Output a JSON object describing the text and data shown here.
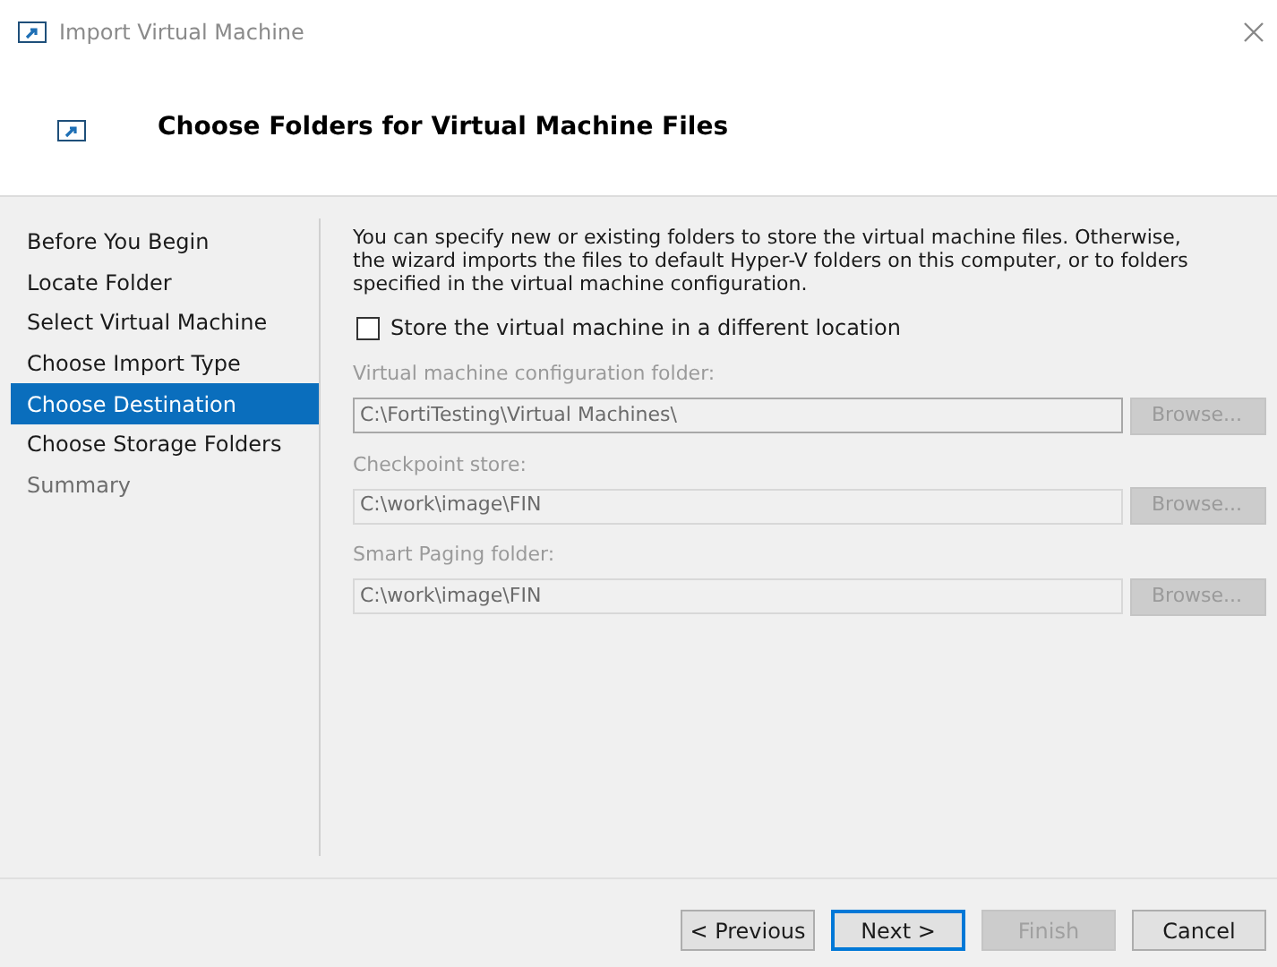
{
  "window": {
    "title": "Import Virtual Machine"
  },
  "header": {
    "title": "Choose Folders for Virtual Machine Files"
  },
  "steps": [
    {
      "label": "Before You Begin",
      "selected": false,
      "disabled": false
    },
    {
      "label": "Locate Folder",
      "selected": false,
      "disabled": false
    },
    {
      "label": "Select Virtual Machine",
      "selected": false,
      "disabled": false
    },
    {
      "label": "Choose Import Type",
      "selected": false,
      "disabled": false
    },
    {
      "label": "Choose Destination",
      "selected": true,
      "disabled": false
    },
    {
      "label": "Choose Storage Folders",
      "selected": false,
      "disabled": false
    },
    {
      "label": "Summary",
      "selected": false,
      "disabled": true
    }
  ],
  "description": "You can specify new or existing folders to store the virtual machine files. Otherwise, the wizard imports the files to default Hyper-V folders on this computer, or to folders specified in the virtual machine configuration.",
  "store_option": {
    "label": "Store the virtual machine in a different location",
    "checked": false
  },
  "folders": [
    {
      "label": "Virtual machine configuration folder:",
      "value": "C:\\FortiTesting\\Virtual Machines\\",
      "focused": true,
      "browse": "Browse..."
    },
    {
      "label": "Checkpoint store:",
      "value": "C:\\work\\image\\FIN",
      "focused": false,
      "browse": "Browse..."
    },
    {
      "label": "Smart Paging folder:",
      "value": "C:\\work\\image\\FIN",
      "focused": false,
      "browse": "Browse..."
    }
  ],
  "buttons": [
    {
      "label": "< Previous",
      "default": false,
      "disabled": false
    },
    {
      "label": "Next >",
      "default": true,
      "disabled": false
    },
    {
      "label": "Finish",
      "default": false,
      "disabled": true
    },
    {
      "label": "Cancel",
      "default": false,
      "disabled": false
    }
  ]
}
